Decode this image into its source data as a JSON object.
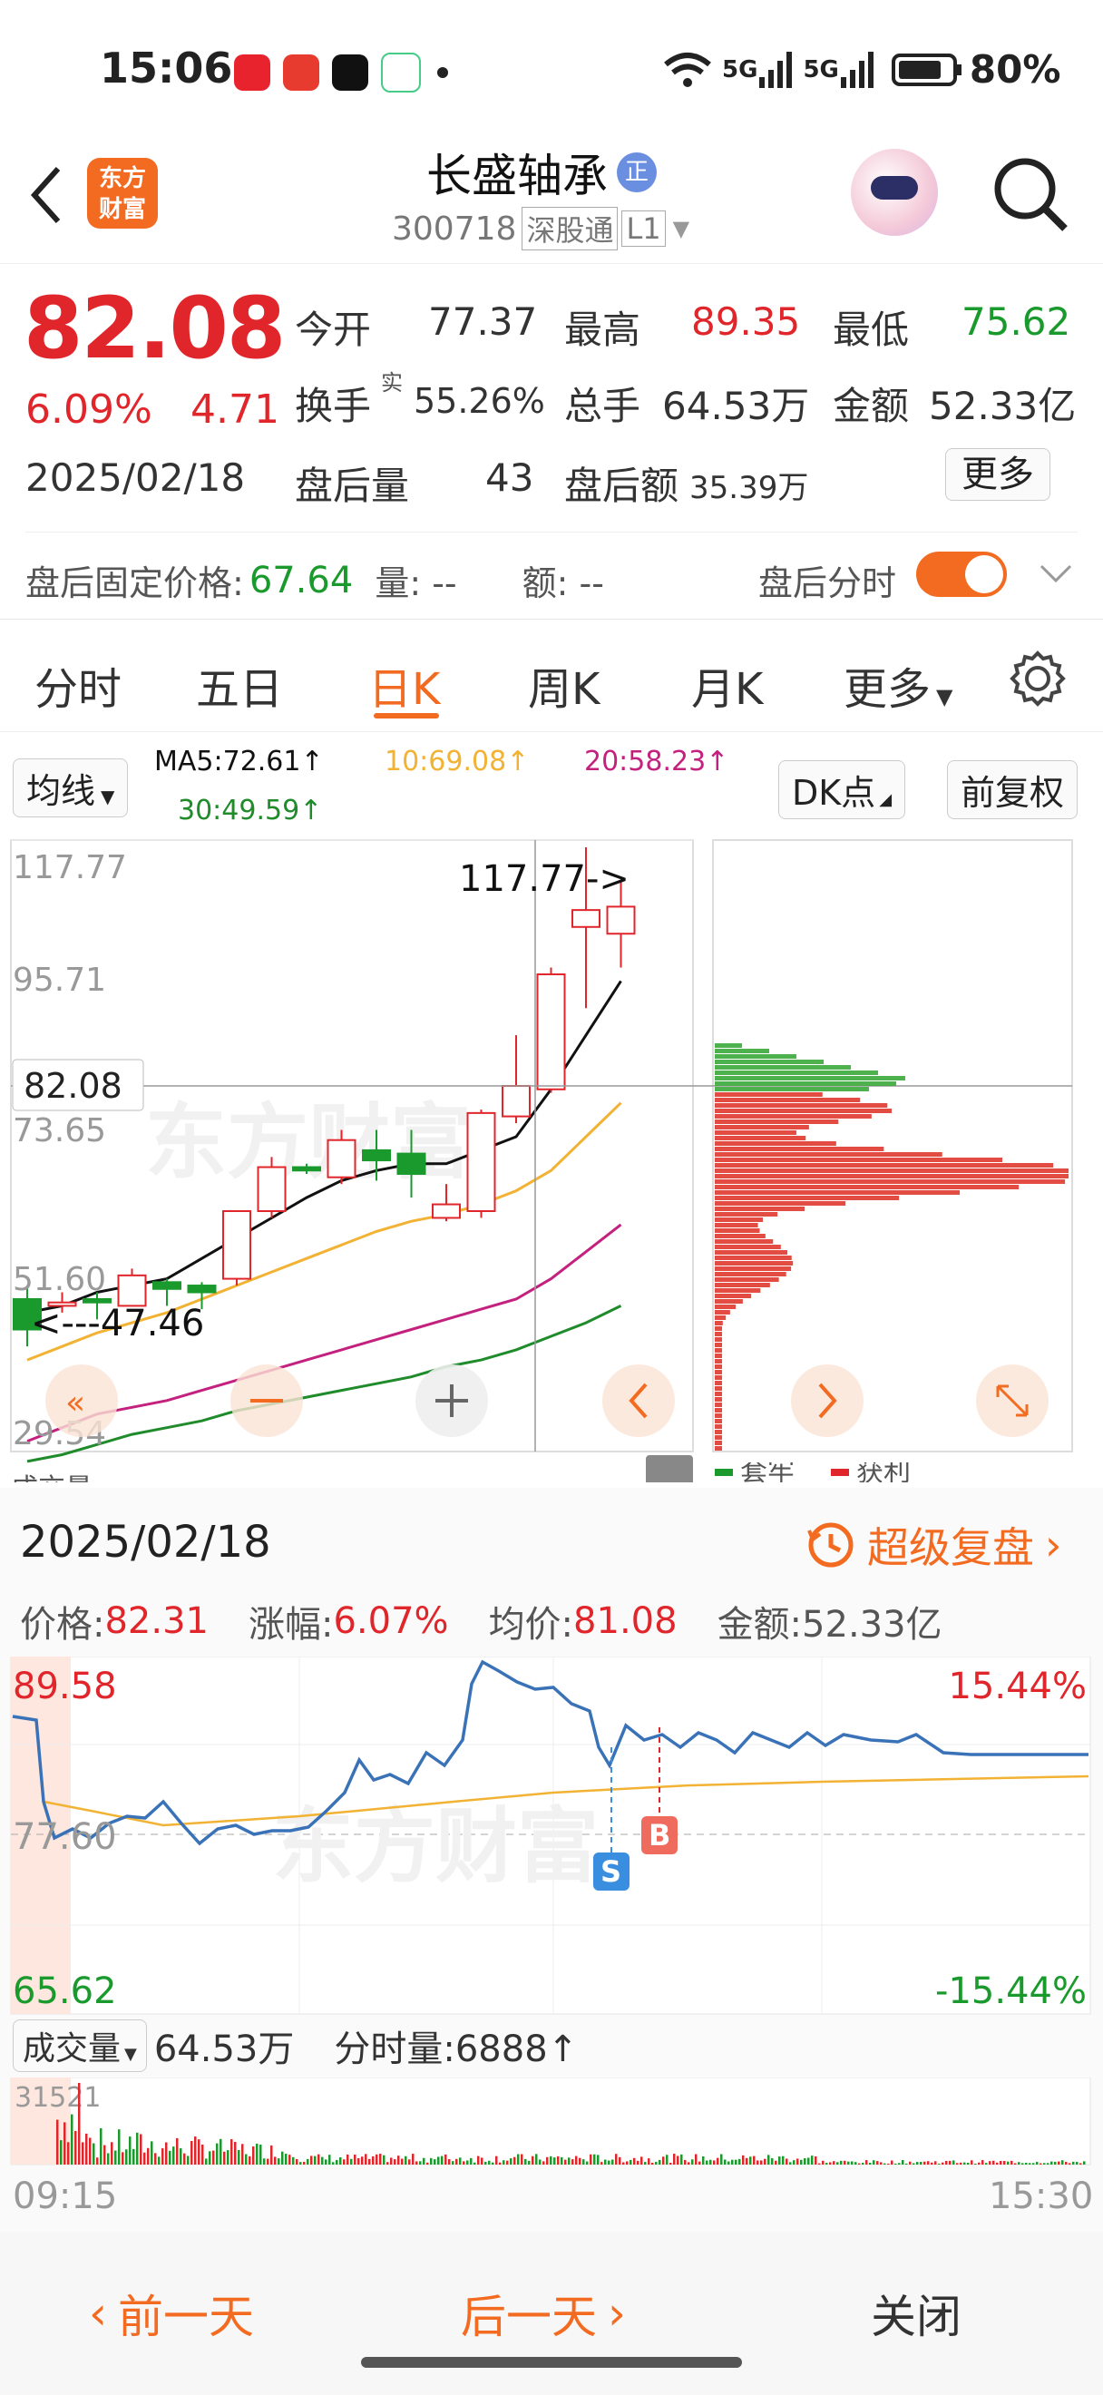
{
  "status": {
    "time": "15:06",
    "signal1": "5G",
    "signal2": "5G",
    "battery": "80%"
  },
  "header": {
    "back_icon": "chevron-left-icon",
    "logo_line1": "东方",
    "logo_line2": "财富",
    "stock_name": "长盛轴承",
    "badge": "正",
    "code": "300718",
    "market": "深股通",
    "level": "L1"
  },
  "quote": {
    "price": "82.08",
    "change_pct": "6.09%",
    "change": "4.71",
    "date": "2025/02/18",
    "open_label": "今开",
    "open": "77.37",
    "high_label": "最高",
    "high": "89.35",
    "low_label": "最低",
    "low": "75.62",
    "turnover_label": "换手",
    "turnover_sup": "实",
    "turnover": "55.26%",
    "vol_label": "总手",
    "vol": "64.53万",
    "amount_label": "金额",
    "amount": "52.33亿",
    "after_vol_label": "盘后量",
    "after_vol": "43",
    "after_amt_label": "盘后额",
    "after_amt": "35.39万",
    "more": "更多",
    "fixed_label": "盘后固定价格:",
    "fixed_price": "67.64",
    "fixed_vol_label": "量: --",
    "fixed_amt_label": "额: --",
    "after_minute_label": "盘后分时"
  },
  "tabs": [
    "分时",
    "五日",
    "日K",
    "周K",
    "月K",
    "更多"
  ],
  "kline": {
    "ma_selector": "均线",
    "ma5": "MA5:72.61↑",
    "ma10": "10:69.08↑",
    "ma20": "20:58.23↑",
    "ma30": "30:49.59↑",
    "dk_btn": "DK点",
    "fq_btn": "前复权",
    "y_labels": [
      "117.77",
      "95.71",
      "73.65",
      "51.60",
      "29.54"
    ],
    "current_price": "82.08",
    "max_annot": "117.77->",
    "min_annot": "<---47.46",
    "vol_label": "成交量",
    "legend_loss": "套牢",
    "legend_profit": "获利"
  },
  "chart_data": {
    "type": "candlestick",
    "ylim": [
      29.54,
      117.77
    ],
    "candles": [
      {
        "o": 51.0,
        "c": 46.5,
        "h": 53.0,
        "l": 44.0
      },
      {
        "o": 50.0,
        "c": 50.5,
        "h": 52.0,
        "l": 49.0
      },
      {
        "o": 51.0,
        "c": 50.5,
        "h": 52.0,
        "l": 48.0
      },
      {
        "o": 50.0,
        "c": 54.5,
        "h": 55.5,
        "l": 50.0
      },
      {
        "o": 53.5,
        "c": 52.5,
        "h": 54.0,
        "l": 50.0
      },
      {
        "o": 53.0,
        "c": 52.0,
        "h": 53.5,
        "l": 49.5
      },
      {
        "o": 54.0,
        "c": 64.0,
        "h": 64.0,
        "l": 53.0
      },
      {
        "o": 64.0,
        "c": 70.5,
        "h": 72.0,
        "l": 63.0
      },
      {
        "o": 70.5,
        "c": 70.0,
        "h": 71.0,
        "l": 69.5
      },
      {
        "o": 69.0,
        "c": 74.5,
        "h": 76.0,
        "l": 68.0
      },
      {
        "o": 73.0,
        "c": 71.5,
        "h": 76.0,
        "l": 68.5
      },
      {
        "o": 72.5,
        "c": 69.5,
        "h": 76.0,
        "l": 66.0
      },
      {
        "o": 63.0,
        "c": 65.0,
        "h": 68.0,
        "l": 62.5
      },
      {
        "o": 64.0,
        "c": 78.5,
        "h": 79.0,
        "l": 63.0
      },
      {
        "o": 78.0,
        "c": 82.5,
        "h": 90.0,
        "l": 77.0
      },
      {
        "o": 82.0,
        "c": 99.0,
        "h": 100.0,
        "l": 81.5
      },
      {
        "o": 106.0,
        "c": 108.5,
        "h": 117.77,
        "l": 94.0
      },
      {
        "o": 105.0,
        "c": 109.0,
        "h": 113.0,
        "l": 100.0
      }
    ],
    "ma5": [
      49.0,
      50.0,
      52.0,
      53.0,
      54.0,
      57.0,
      60.0,
      63.0,
      66.0,
      68.5,
      70.0,
      71.0,
      71.0,
      73.0,
      75.0,
      82.0,
      90.0,
      98.0
    ],
    "ma10": [
      42.0,
      44.0,
      46.0,
      47.5,
      49.0,
      51.0,
      53.0,
      55.0,
      57.0,
      59.0,
      61.0,
      62.5,
      63.5,
      65.0,
      67.0,
      70.0,
      75.0,
      80.0
    ],
    "ma20": [
      30.0,
      32.0,
      34.0,
      35.0,
      36.0,
      37.5,
      39.0,
      40.5,
      42.0,
      43.5,
      45.0,
      46.5,
      48.0,
      49.5,
      51.0,
      54.0,
      58.0,
      62.0
    ],
    "ma30": [
      27.0,
      28.0,
      29.5,
      31.0,
      32.0,
      33.0,
      34.5,
      35.5,
      36.5,
      37.5,
      38.5,
      39.5,
      41.0,
      42.0,
      43.5,
      45.5,
      47.5,
      50.0
    ]
  },
  "minute": {
    "date": "2025/02/18",
    "super_review": "超级复盘",
    "price_label": "价格:",
    "price": "82.31",
    "chg_label": "涨幅:",
    "chg": "6.07%",
    "avg_label": "均价:",
    "avg": "81.08",
    "amt_label": "金额:",
    "amt": "52.33亿",
    "y_high": "89.58",
    "y_mid": "77.60",
    "y_low": "65.62",
    "pct_high": "15.44%",
    "pct_low": "-15.44%",
    "marker_s": "S",
    "marker_b": "B",
    "vol_selector": "成交量",
    "vol_total": "64.53万",
    "vol_now": "分时量:6888↑",
    "vol_max": "31521",
    "t_start": "09:15",
    "t_end": "15:30"
  },
  "bottom": {
    "prev": "前一天",
    "next": "后一天",
    "close": "关闭"
  },
  "colors": {
    "up": "#e0252b",
    "down": "#1a9a2c",
    "ma5": "#111111",
    "ma10": "#f2b233",
    "ma20": "#c4217f",
    "ma30": "#1f8b2b",
    "accent": "#f36b21"
  }
}
